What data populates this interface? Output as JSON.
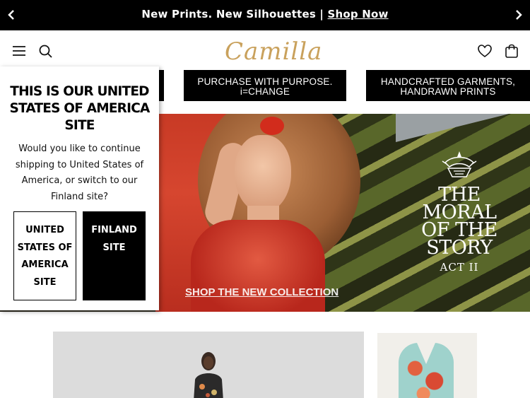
{
  "announcement": {
    "text": "New Prints. New Silhouettes | ",
    "link": "Shop Now"
  },
  "header": {
    "logo_text": "Camilla",
    "icons": [
      "menu-icon",
      "search-icon",
      "wishlist-heart-icon",
      "shopping-bag-icon"
    ]
  },
  "categories": [
    {
      "label": ""
    },
    {
      "label": "PURCHASE WITH PURPOSE. i=CHANGE"
    },
    {
      "label": "HANDCRAFTED GARMENTS, HANDRAWN PRINTS"
    }
  ],
  "hero": {
    "title_lines": [
      "THE",
      "MORAL",
      "OF THE",
      "STORY"
    ],
    "subtitle": "ACT II",
    "cta": "SHOP THE NEW COLLECTION"
  },
  "popup": {
    "title": "THIS IS OUR UNITED STATES OF AMERICA SITE",
    "body": "Would you like to continue shipping to United States of America, or switch to our Finland site?",
    "primary_button": "UNITED STATES OF AMERICA SITE",
    "secondary_button": "FINLAND SITE"
  },
  "colors": {
    "logo_gold": "#c9a15c",
    "announcement_bg": "#000000",
    "button_dark": "#000000"
  }
}
